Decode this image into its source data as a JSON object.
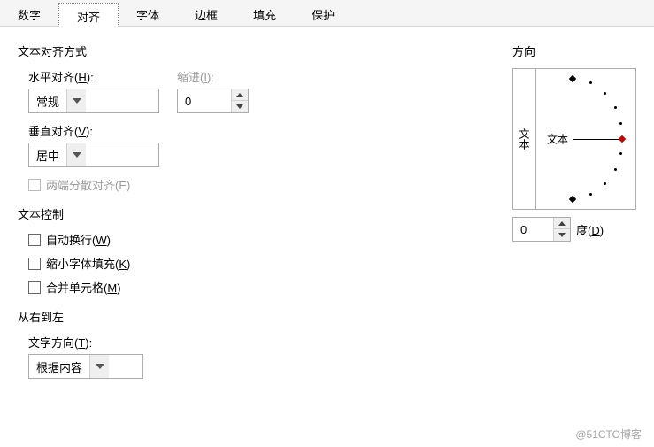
{
  "tabs": [
    "数字",
    "对齐",
    "字体",
    "边框",
    "填充",
    "保护"
  ],
  "activeTab": 1,
  "sections": {
    "textAlignment": {
      "title": "文本对齐方式",
      "horizontal": {
        "label_pre": "水平对齐(",
        "mnemonic": "H",
        "label_post": "):",
        "value": "常规"
      },
      "indent": {
        "label_pre": "缩进(",
        "mnemonic": "I",
        "label_post": "):",
        "value": "0"
      },
      "vertical": {
        "label_pre": "垂直对齐(",
        "mnemonic": "V",
        "label_post": "):",
        "value": "居中"
      },
      "justify": {
        "label": "两端分散对齐(E)",
        "enabled": false
      }
    },
    "textControl": {
      "title": "文本控制",
      "wrap": {
        "label_pre": "自动换行(",
        "mnemonic": "W",
        "label_post": ")"
      },
      "shrink": {
        "label_pre": "缩小字体填充(",
        "mnemonic": "K",
        "label_post": ")"
      },
      "merge": {
        "label_pre": "合并单元格(",
        "mnemonic": "M",
        "label_post": ")"
      }
    },
    "rtl": {
      "title": "从右到左",
      "textDir": {
        "label_pre": "文字方向(",
        "mnemonic": "T",
        "label_post": "):",
        "value": "根据内容"
      }
    },
    "orientation": {
      "title": "方向",
      "vertText": "文本",
      "centerText": "文本",
      "degreeValue": "0",
      "degreeLabel_pre": "度(",
      "degreeMnemonic": "D",
      "degreeLabel_post": ")"
    }
  },
  "watermark": "@51CTO博客"
}
